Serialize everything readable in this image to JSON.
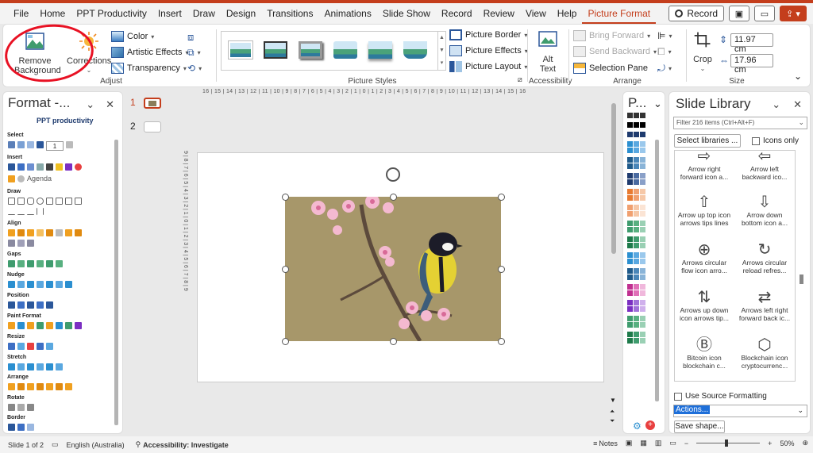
{
  "menu": {
    "items": [
      "File",
      "Home",
      "PPT Productivity",
      "Insert",
      "Draw",
      "Design",
      "Transitions",
      "Animations",
      "Slide Show",
      "Record",
      "Review",
      "View",
      "Help",
      "Picture Format"
    ],
    "active": "Picture Format",
    "record_label": "Record"
  },
  "ribbon": {
    "adjust": {
      "remove_background": "Remove Background",
      "corrections": "Corrections",
      "color": "Color",
      "artistic_effects": "Artistic Effects",
      "transparency": "Transparency",
      "label": "Adjust"
    },
    "picture_styles": {
      "picture_border": "Picture Border",
      "picture_effects": "Picture Effects",
      "picture_layout": "Picture Layout",
      "label": "Picture Styles"
    },
    "accessibility": {
      "alt_text": "Alt Text",
      "label": "Accessibility"
    },
    "arrange": {
      "bring_forward": "Bring Forward",
      "send_backward": "Send Backward",
      "selection_pane": "Selection Pane",
      "label": "Arrange"
    },
    "size": {
      "crop": "Crop",
      "height": "11.97 cm",
      "width": "17.96 cm",
      "label": "Size"
    }
  },
  "format_pane": {
    "title": "Format -...",
    "logo": "PPT productivity",
    "sections": [
      "Select",
      "Insert",
      "Draw",
      "Align",
      "Gaps",
      "Nudge",
      "Position",
      "Paint Format",
      "Resize",
      "Stretch",
      "Arrange",
      "Rotate",
      "Border"
    ],
    "select_value": "1",
    "agenda_label": "Agenda"
  },
  "slides": {
    "numbers": [
      "1",
      "2"
    ]
  },
  "ruler": {
    "horizontal": "16 | 15 | 14 | 13 | 12 | 11 | 10 | 9 | 8 | 7 | 6 | 5 | 4 | 3 | 2 | 1 | 0 | 1 | 2 | 3 | 4 | 5 | 6 | 7 | 8 | 9 | 10 | 11 | 12 | 13 | 14 | 15 | 16",
    "vertical": "9 | 8 | 7 | 6 | 5 | 4 | 3 | 2 | 1 | 0 | 1 | 2 | 3 | 4 | 5 | 6 | 7 | 8 | 9"
  },
  "palette_pane": {
    "title": "P..."
  },
  "library": {
    "title": "Slide Library",
    "filter_placeholder": "Filter 216 items (Ctrl+Alt+F)",
    "select_libraries": "Select libraries ...",
    "icons_only": "Icons only",
    "items": [
      {
        "glyph": "⇨",
        "label": "Arrow right forward icon a..."
      },
      {
        "glyph": "⇦",
        "label": "Arrow left backward ico..."
      },
      {
        "glyph": "⇧",
        "label": "Arrow up top icon arrows tips lines"
      },
      {
        "glyph": "⇩",
        "label": "Arrow down bottom icon a..."
      },
      {
        "glyph": "⊕",
        "label": "Arrows circular flow icon arro..."
      },
      {
        "glyph": "↻",
        "label": "Arrows circular reload refres..."
      },
      {
        "glyph": "⇅",
        "label": "Arrows up down icon arrows tip..."
      },
      {
        "glyph": "⇄",
        "label": "Arrows left right forward back ic..."
      },
      {
        "glyph": "Ⓑ",
        "label": "Bitcoin icon blockchain c..."
      },
      {
        "glyph": "⬡",
        "label": "Blockchain icon cryptocurrenc..."
      }
    ],
    "use_source_formatting": "Use Source Formatting",
    "actions_value": "Actions...",
    "save_shape": "Save shape..."
  },
  "status": {
    "slide": "Slide 1 of 2",
    "language": "English (Australia)",
    "accessibility": "Accessibility: Investigate",
    "notes": "Notes",
    "zoom": "50%"
  },
  "colors": {
    "accent": "#c43e1c",
    "annotation": "#e81123",
    "selection": "#1e6fd9"
  }
}
